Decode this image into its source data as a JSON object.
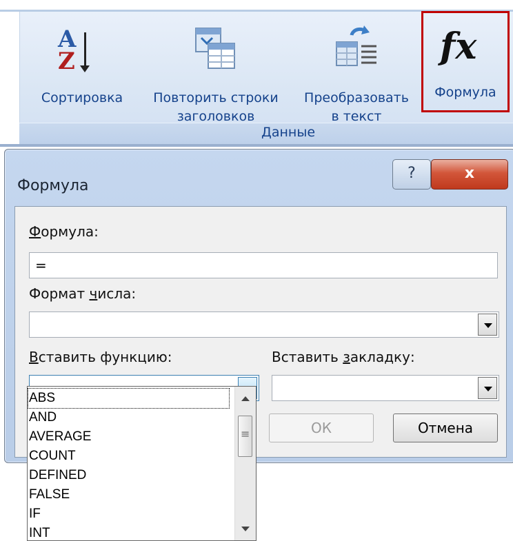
{
  "ribbon": {
    "group_label": "Данные",
    "buttons": [
      {
        "label": "Сортировка",
        "icon": "sort-az-icon"
      },
      {
        "label_line1": "Повторить строки",
        "label_line2": "заголовков",
        "icon": "repeat-header-rows-icon"
      },
      {
        "label_line1": "Преобразовать",
        "label_line2": "в текст",
        "icon": "convert-to-text-icon"
      },
      {
        "label": "Формула",
        "icon": "fx-icon",
        "highlighted": true
      }
    ]
  },
  "dialog": {
    "title": "Формула",
    "help_label": "?",
    "close_label": "x",
    "formula_label_u": "Ф",
    "formula_label_rest": "ормула:",
    "formula_value": "=",
    "number_format_label_pre": "Формат ",
    "number_format_label_u": "ч",
    "number_format_label_post": "исла:",
    "number_format_value": "",
    "insert_function_label_u": "В",
    "insert_function_label_rest": "ставить функцию:",
    "insert_bookmark_label_pre": "Вставить ",
    "insert_bookmark_label_u": "з",
    "insert_bookmark_label_post": "акладку:",
    "ok_label": "ОК",
    "cancel_label": "Отмена"
  },
  "function_list": [
    "ABS",
    "AND",
    "AVERAGE",
    "COUNT",
    "DEFINED",
    "FALSE",
    "IF",
    "INT"
  ],
  "colors": {
    "highlight_border": "#c00000",
    "ribbon_text": "#15428b",
    "close_button": "#c0391d"
  }
}
